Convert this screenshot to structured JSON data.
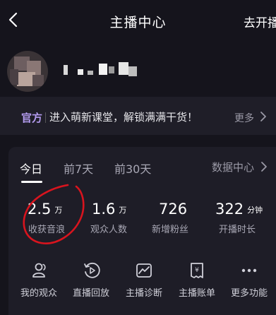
{
  "nav": {
    "title": "主播中心",
    "right_action": "去开播"
  },
  "banner": {
    "tag": "官方",
    "text": "进入萌新课堂，解锁满满干货！",
    "more": "更多"
  },
  "tabs": [
    {
      "label": "今日",
      "active": true
    },
    {
      "label": "前7天",
      "active": false
    },
    {
      "label": "前30天",
      "active": false
    }
  ],
  "data_center": "数据中心",
  "stats": [
    {
      "value": "2.5",
      "unit": "万",
      "label": "收获音浪"
    },
    {
      "value": "1.6",
      "unit": "万",
      "label": "观众人数"
    },
    {
      "value": "726",
      "unit": "",
      "label": "新增粉丝"
    },
    {
      "value": "322",
      "unit": "分钟",
      "label": "开播时长"
    }
  ],
  "functions": [
    {
      "label": "我的观众",
      "icon": "audience-icon"
    },
    {
      "label": "直播回放",
      "icon": "replay-icon"
    },
    {
      "label": "主播诊断",
      "icon": "diagnosis-icon"
    },
    {
      "label": "主播账单",
      "icon": "bill-icon"
    },
    {
      "label": "更多功能",
      "icon": "more-icon"
    }
  ],
  "colors": {
    "background": "#15141c",
    "card": "#1e1d27",
    "tag": "#b49cf0",
    "annotation": "#d8141e"
  }
}
